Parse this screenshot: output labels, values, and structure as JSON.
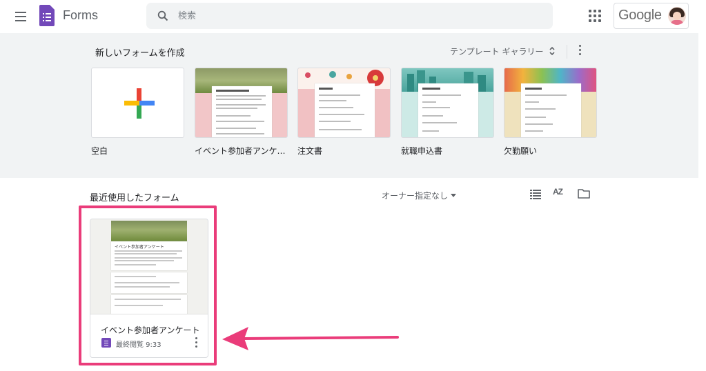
{
  "header": {
    "app_title": "Forms",
    "search_placeholder": "検索",
    "account_logo": "Google",
    "icons": [
      "menu-icon",
      "forms-logo-icon",
      "search-icon",
      "apps-grid-icon",
      "avatar"
    ]
  },
  "gallery": {
    "title": "新しいフォームを作成",
    "toggle_label": "テンプレート ギャラリー",
    "templates": [
      {
        "label": "空白",
        "style": "blank"
      },
      {
        "label": "イベント参加者アンケ…",
        "style": "event",
        "sheet_title": "イベント参加者アンケート"
      },
      {
        "label": "注文書",
        "style": "order",
        "sheet_title": "注文書"
      },
      {
        "label": "就職申込書",
        "style": "job",
        "sheet_title": "就職申込書"
      },
      {
        "label": "欠勤願い",
        "style": "absence",
        "sheet_title": "欠勤願い"
      }
    ]
  },
  "recent": {
    "title": "最近使用したフォーム",
    "owner_filter": "オーナー指定なし",
    "sort_icon_text": "AZ",
    "documents": [
      {
        "title": "イベント参加者アンケート",
        "meta": "最終閲覧 9:33",
        "preview_title": "イベント参加者アンケート"
      }
    ]
  },
  "colors": {
    "forms_purple": "#7248b9",
    "gallery_bg": "#f1f3f4",
    "highlight_pink": "#ea3c7a"
  }
}
